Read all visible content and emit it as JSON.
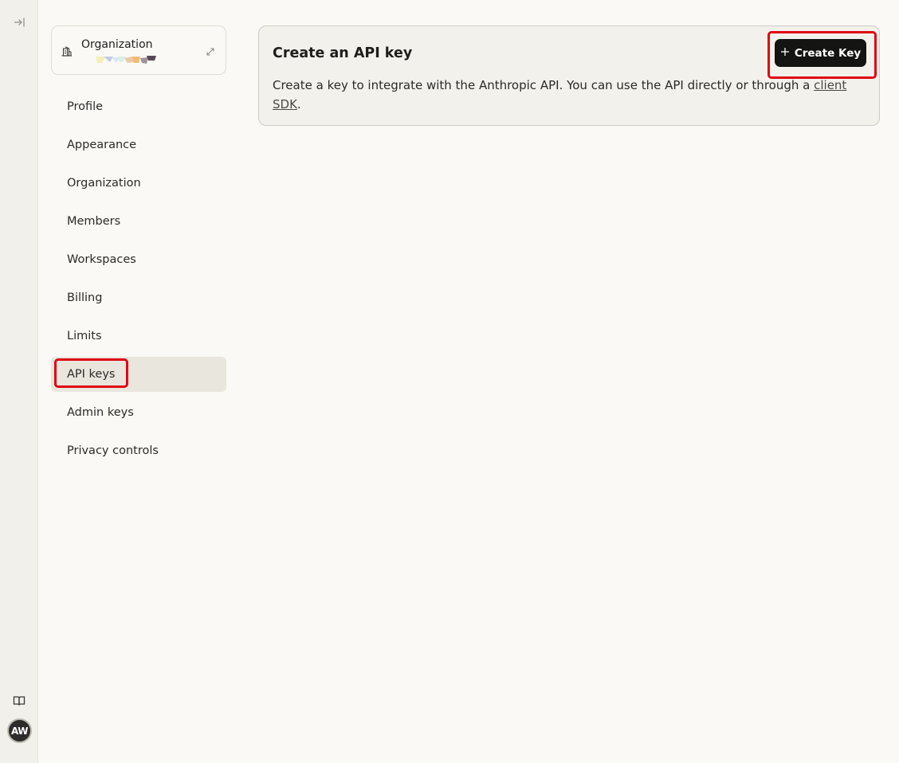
{
  "rail": {
    "toggle_icon": "sidebar-expand-icon",
    "book_icon": "book-icon",
    "avatar_initials": "AW"
  },
  "org_switcher": {
    "title": "Organization",
    "building_icon": "building-icon",
    "expand_icon": "expand-arrows-icon"
  },
  "nav": {
    "items": [
      {
        "label": "Profile"
      },
      {
        "label": "Appearance"
      },
      {
        "label": "Organization"
      },
      {
        "label": "Members"
      },
      {
        "label": "Workspaces"
      },
      {
        "label": "Billing"
      },
      {
        "label": "Limits"
      },
      {
        "label": "API keys"
      },
      {
        "label": "Admin keys"
      },
      {
        "label": "Privacy controls"
      }
    ],
    "active": "API keys"
  },
  "api_card": {
    "title": "Create an API key",
    "description": "Create a key to integrate with the Anthropic API. You can use the API directly or through a ",
    "link_text": "client SDK",
    "description_end": ".",
    "button_label": "Create Key",
    "button_icon": "plus-icon"
  },
  "colors": {
    "highlight": "#e00512",
    "button_bg": "#141413",
    "active_nav_bg": "#e9e6de"
  }
}
